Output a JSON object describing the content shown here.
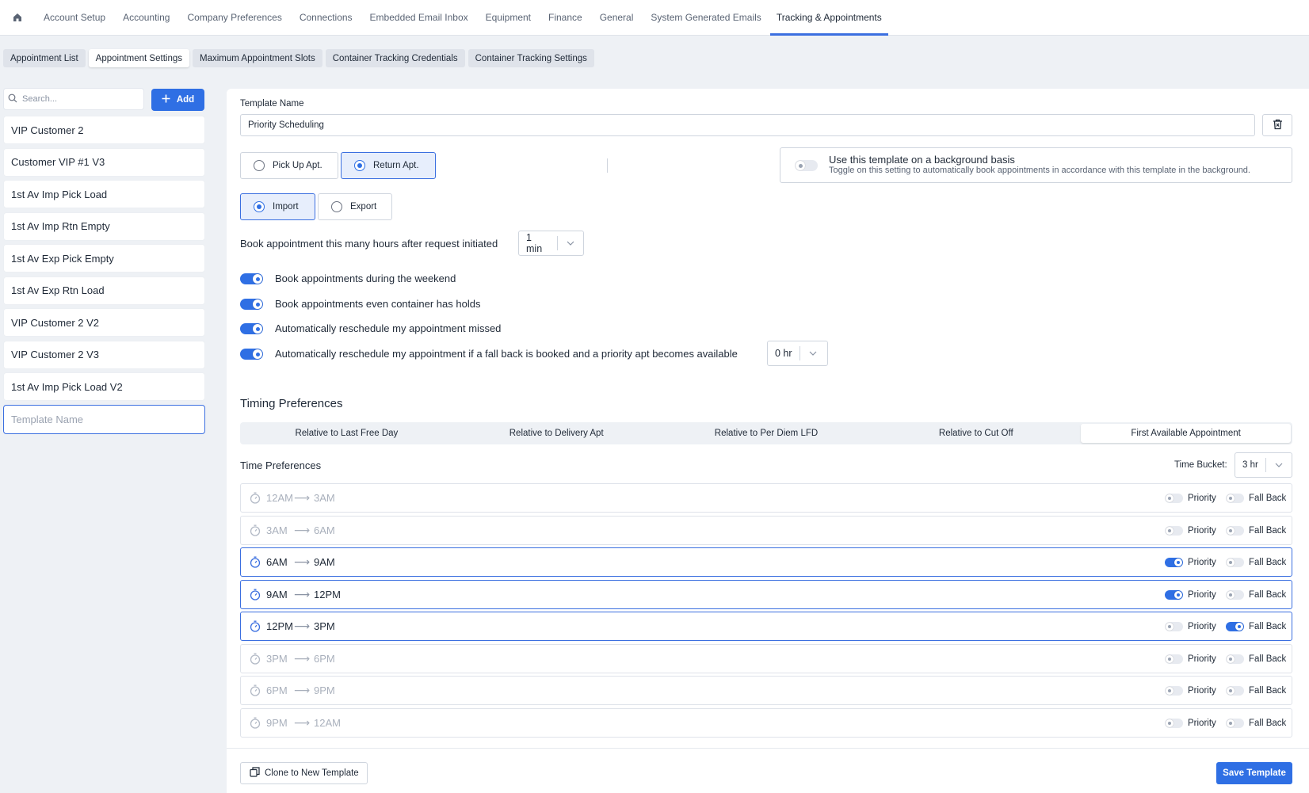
{
  "topnav": {
    "tabs": [
      "Account Setup",
      "Accounting",
      "Company Preferences",
      "Connections",
      "Embedded Email Inbox",
      "Equipment",
      "Finance",
      "General",
      "System Generated Emails",
      "Tracking & Appointments"
    ]
  },
  "subtabs": [
    "Appointment List",
    "Appointment Settings",
    "Maximum Appointment Slots",
    "Container Tracking Credentials",
    "Container Tracking Settings"
  ],
  "sidebar": {
    "search_placeholder": "Search...",
    "add_label": "Add",
    "items": [
      "VIP Customer 2",
      "Customer VIP #1 V3",
      "1st Av Imp Pick Load",
      "1st Av Imp Rtn Empty",
      "1st Av Exp Pick Empty",
      "1st Av Exp Rtn Load",
      "VIP Customer 2 V2",
      "VIP Customer 2 V3",
      "1st Av Imp Pick Load V2"
    ],
    "new_template_placeholder": "Template Name"
  },
  "form": {
    "template_name_label": "Template Name",
    "template_name_value": "Priority Scheduling",
    "apt_type": {
      "pickup": "Pick Up Apt.",
      "return": "Return Apt."
    },
    "direction": {
      "import": "Import",
      "export": "Export"
    },
    "background": {
      "title": "Use this template on a background basis",
      "subtitle": "Toggle on this setting to automatically book appointments in accordance with this template in the background."
    },
    "book_after_label": "Book appointment this many hours after request initiated",
    "book_after_value": "1 min",
    "toggles": [
      "Book appointments during the weekend",
      "Book appointments even container has holds",
      "Automatically reschedule my appointment missed",
      "Automatically reschedule my appointment if a fall back is booked and a priority apt becomes available"
    ],
    "reschedule_value": "0 hr"
  },
  "timing": {
    "title": "Timing Preferences",
    "options": [
      "Relative to Last Free Day",
      "Relative to Delivery Apt",
      "Relative to Per Diem LFD",
      "Relative to Cut Off",
      "First Available Appointment"
    ],
    "time_prefs_title": "Time Preferences",
    "time_bucket_label": "Time Bucket:",
    "time_bucket_value": "3 hr",
    "priority_label": "Priority",
    "fallback_label": "Fall Back",
    "slots": [
      {
        "from": "12AM",
        "to": "3AM",
        "priority": false,
        "fallback": false
      },
      {
        "from": "3AM",
        "to": "6AM",
        "priority": false,
        "fallback": false
      },
      {
        "from": "6AM",
        "to": "9AM",
        "priority": true,
        "fallback": false
      },
      {
        "from": "9AM",
        "to": "12PM",
        "priority": true,
        "fallback": false
      },
      {
        "from": "12PM",
        "to": "3PM",
        "priority": false,
        "fallback": true
      },
      {
        "from": "3PM",
        "to": "6PM",
        "priority": false,
        "fallback": false
      },
      {
        "from": "6PM",
        "to": "9PM",
        "priority": false,
        "fallback": false
      },
      {
        "from": "9PM",
        "to": "12AM",
        "priority": false,
        "fallback": false
      }
    ]
  },
  "footer": {
    "clone_label": "Clone to New Template",
    "save_label": "Save Template"
  },
  "colors": {
    "accent": "#2f6fe4",
    "background": "#eef1f5"
  }
}
